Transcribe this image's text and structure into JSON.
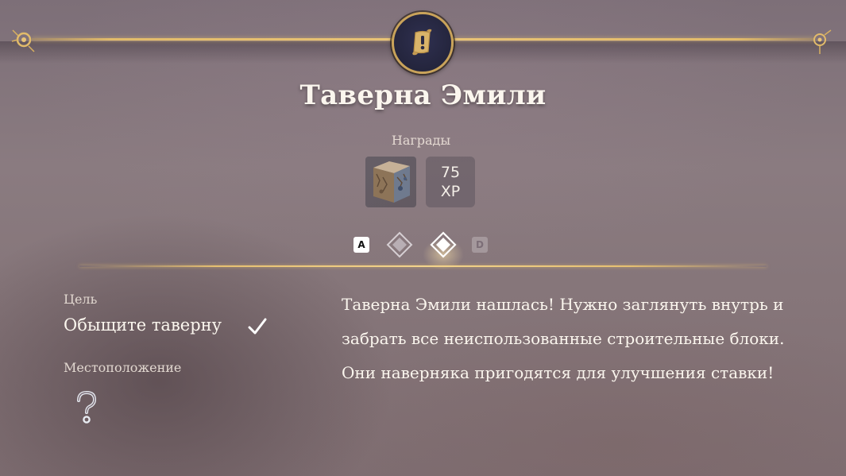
{
  "quest": {
    "title": "Таверна Эмили",
    "rewards_label": "Награды",
    "reward_item_icon": "stone-block-icon",
    "xp_value": "75",
    "xp_unit": "XP"
  },
  "navigation": {
    "prev_key": "A",
    "next_key": "D",
    "pages_total": 2,
    "current_page": 2
  },
  "objective": {
    "goal_label": "Цель",
    "goal_text": "Обыщите таверну",
    "goal_completed": true,
    "location_label": "Местоположение",
    "location_icon": "unknown-location-icon"
  },
  "description": "Таверна Эмили нашлась! Нужно заглянуть внутрь и забрать все неиспользованные строительные блоки. Они наверняка пригодятся для улучшения ставки!",
  "colors": {
    "gold": "#e2bb6a",
    "badge_bg": "#24253d",
    "text": "#fbf6ee"
  }
}
